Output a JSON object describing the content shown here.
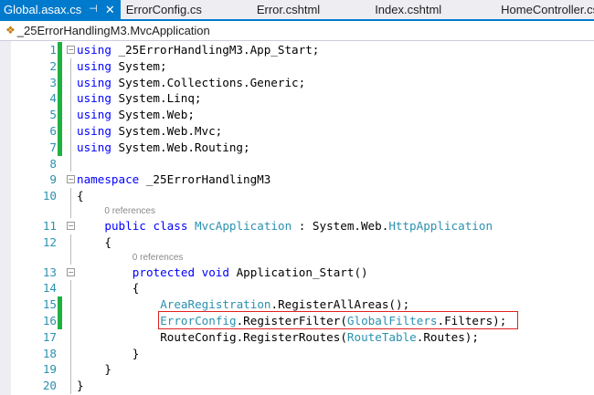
{
  "tabs": [
    {
      "label": "Global.asax.cs",
      "active": true
    },
    {
      "label": "ErrorConfig.cs"
    },
    {
      "label": "Error.cshtml"
    },
    {
      "label": "Index.cshtml"
    },
    {
      "label": "HomeController.cs"
    }
  ],
  "breadcrumb": "_25ErrorHandlingM3.MvcApplication",
  "colors": {
    "accent": "#007acc",
    "keyword": "#0000ff",
    "type": "#2b91af",
    "highlight_box": "#e02020",
    "changed": "#1fb040"
  },
  "lines": [
    {
      "n": "1",
      "fold": true,
      "chg": true,
      "indent": 0,
      "tokens": [
        [
          "kw",
          "using"
        ],
        [
          "pl",
          " _25ErrorHandlingM3.App_Start;"
        ]
      ]
    },
    {
      "n": "2",
      "chg": true,
      "indent": 0,
      "tokens": [
        [
          "kw",
          "using"
        ],
        [
          "pl",
          " System;"
        ]
      ]
    },
    {
      "n": "3",
      "chg": true,
      "indent": 0,
      "tokens": [
        [
          "kw",
          "using"
        ],
        [
          "pl",
          " System.Collections.Generic;"
        ]
      ]
    },
    {
      "n": "4",
      "chg": true,
      "indent": 0,
      "tokens": [
        [
          "kw",
          "using"
        ],
        [
          "pl",
          " System.Linq;"
        ]
      ]
    },
    {
      "n": "5",
      "chg": true,
      "indent": 0,
      "tokens": [
        [
          "kw",
          "using"
        ],
        [
          "pl",
          " System.Web;"
        ]
      ]
    },
    {
      "n": "6",
      "chg": true,
      "indent": 0,
      "tokens": [
        [
          "kw",
          "using"
        ],
        [
          "pl",
          " System.Web.Mvc;"
        ]
      ]
    },
    {
      "n": "7",
      "chg": true,
      "indent": 0,
      "tokens": [
        [
          "kw",
          "using"
        ],
        [
          "pl",
          " System.Web.Routing;"
        ]
      ]
    },
    {
      "n": "8",
      "indent": 0,
      "tokens": []
    },
    {
      "n": "9",
      "fold": true,
      "indent": 0,
      "tokens": [
        [
          "kw",
          "namespace"
        ],
        [
          "pl",
          " _25ErrorHandlingM3"
        ]
      ]
    },
    {
      "n": "10",
      "indent": 0,
      "tokens": [
        [
          "pl",
          "{"
        ]
      ]
    },
    {
      "refs": "0 references",
      "indent": 4
    },
    {
      "n": "11",
      "fold": true,
      "indent": 4,
      "tokens": [
        [
          "kw",
          "public"
        ],
        [
          "pl",
          " "
        ],
        [
          "kw",
          "class"
        ],
        [
          "pl",
          " "
        ],
        [
          "ty",
          "MvcApplication"
        ],
        [
          "pl",
          " : System.Web."
        ],
        [
          "ty",
          "HttpApplication"
        ]
      ]
    },
    {
      "n": "12",
      "indent": 4,
      "tokens": [
        [
          "pl",
          "{"
        ]
      ]
    },
    {
      "refs": "0 references",
      "indent": 8
    },
    {
      "n": "13",
      "fold": true,
      "indent": 8,
      "tokens": [
        [
          "kw",
          "protected"
        ],
        [
          "pl",
          " "
        ],
        [
          "kw",
          "void"
        ],
        [
          "pl",
          " Application_Start()"
        ]
      ]
    },
    {
      "n": "14",
      "indent": 8,
      "tokens": [
        [
          "pl",
          "{"
        ]
      ]
    },
    {
      "n": "15",
      "chg": true,
      "indent": 12,
      "tokens": [
        [
          "ty",
          "AreaRegistration"
        ],
        [
          "pl",
          ".RegisterAllAreas();"
        ]
      ]
    },
    {
      "n": "16",
      "chg": true,
      "box": true,
      "indent": 12,
      "tokens": [
        [
          "ty",
          "ErrorConfig"
        ],
        [
          "pl",
          ".RegisterFilter("
        ],
        [
          "ty",
          "GlobalFilters"
        ],
        [
          "pl",
          ".Filters);"
        ]
      ]
    },
    {
      "n": "17",
      "indent": 12,
      "tokens": [
        [
          "pl",
          "RouteConfig.RegisterRoutes("
        ],
        [
          "ty",
          "RouteTable"
        ],
        [
          "pl",
          ".Routes);"
        ]
      ]
    },
    {
      "n": "18",
      "indent": 8,
      "tokens": [
        [
          "pl",
          "}"
        ]
      ]
    },
    {
      "n": "19",
      "indent": 4,
      "tokens": [
        [
          "pl",
          "}"
        ]
      ]
    },
    {
      "n": "20",
      "indent": 0,
      "tokens": [
        [
          "pl",
          "}"
        ]
      ]
    }
  ]
}
